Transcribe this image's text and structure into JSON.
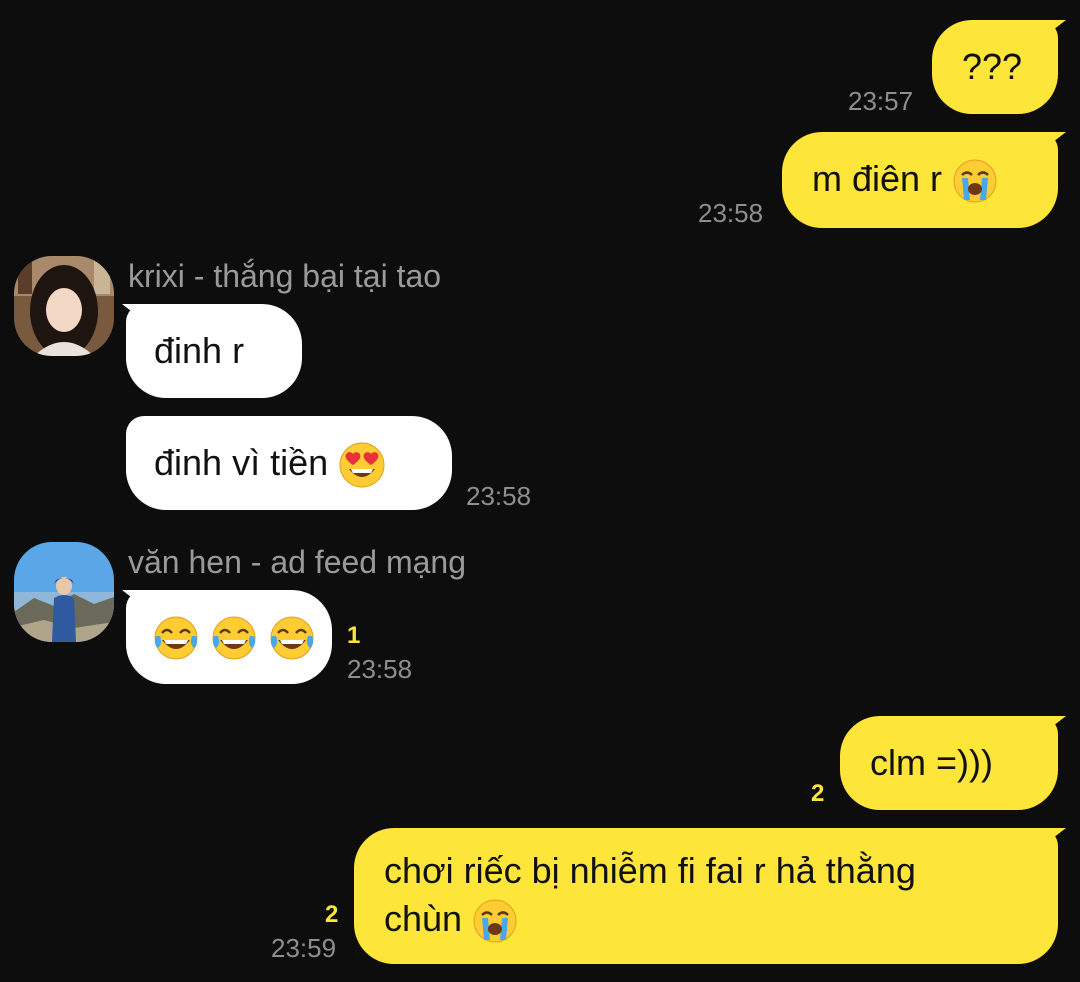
{
  "messages": [
    {
      "text": "???",
      "time": "23:57"
    },
    {
      "text": "m điên r",
      "emoji": "loudly-crying-face",
      "time": "23:58"
    },
    {
      "sender": "krixi - thắng bại tại tao",
      "text": "đinh r"
    },
    {
      "text": "đinh vì tiền",
      "emoji": "heart-eyes-face",
      "time": "23:58"
    },
    {
      "sender": "văn hen - ad feed mạng",
      "emoji": "tears-of-joy-face x3",
      "unread": "1",
      "time": "23:58"
    },
    {
      "text": "clm =)))",
      "unread": "2"
    },
    {
      "text_line1": "chơi riếc bị nhiễm fi fai r hả thằng",
      "text_line2": "chùn",
      "emoji": "loudly-crying-face",
      "unread": "2",
      "time": "23:59"
    }
  ],
  "colors": {
    "background": "#0d0d0d",
    "my_bubble": "#fde53a",
    "their_bubble": "#ffffff",
    "timestamp": "#8e8e8e",
    "unread_count": "#fde53a"
  }
}
